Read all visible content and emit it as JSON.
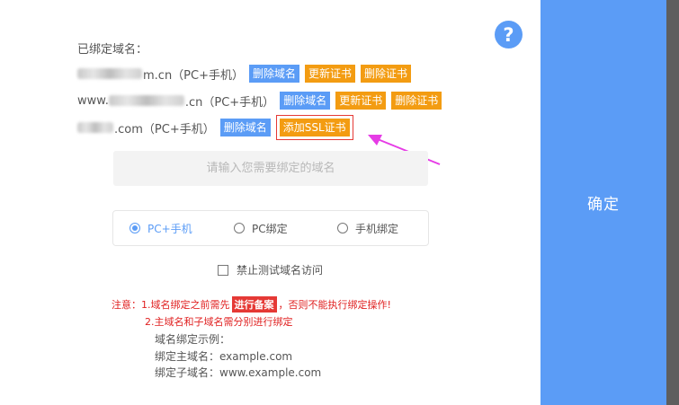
{
  "confirm_label": "确定",
  "help_icon": "?",
  "bound_title": "已绑定域名：",
  "domains": [
    {
      "suffix": "m.cn（PC+手机）",
      "actions": [
        "删除域名",
        "更新证书",
        "删除证书"
      ]
    },
    {
      "prefix": "www.",
      "suffix": ".cn（PC+手机）",
      "actions": [
        "删除域名",
        "更新证书",
        "删除证书"
      ]
    },
    {
      "suffix": ".com（PC+手机）",
      "actions": [
        "删除域名"
      ],
      "ssl_action": "添加SSL证书"
    }
  ],
  "domain_input_placeholder": "请输入您需要绑定的域名",
  "radio_options": [
    {
      "label": "PC+手机",
      "checked": true
    },
    {
      "label": "PC绑定",
      "checked": false
    },
    {
      "label": "手机绑定",
      "checked": false
    }
  ],
  "checkbox_label": "禁止测试域名访问",
  "notes": {
    "line1_pre": "注意：1.域名绑定之前需先",
    "line1_highlight": "进行备案",
    "line1_post": "，否则不能执行绑定操作!",
    "line2": "2.主域名和子域名需分别进行绑定"
  },
  "examples": {
    "title": "域名绑定示例：",
    "main": "绑定主域名：example.com",
    "sub": "绑定子域名：www.example.com"
  },
  "colors": {
    "accent_blue": "#5b9cf6",
    "orange": "#f39c12",
    "warning_red": "#e02020",
    "arrow_magenta": "#e63ce6"
  }
}
